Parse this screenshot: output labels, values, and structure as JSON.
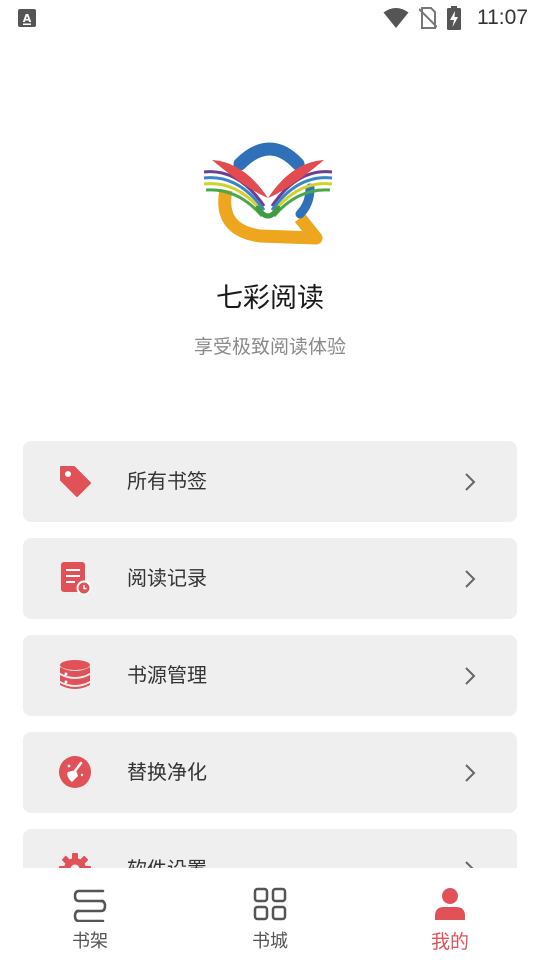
{
  "status_bar": {
    "time": "11:07",
    "icons": [
      "keyboard-a-icon",
      "wifi-icon",
      "no-sim-icon",
      "battery-charging-icon"
    ]
  },
  "header": {
    "logo": "qicai-book-logo",
    "title": "七彩阅读",
    "subtitle": "享受极致阅读体验"
  },
  "menu": {
    "items": [
      {
        "label": "所有书签",
        "icon": "tag-icon"
      },
      {
        "label": "阅读记录",
        "icon": "reading-history-icon"
      },
      {
        "label": "书源管理",
        "icon": "database-icon"
      },
      {
        "label": "替换净化",
        "icon": "broom-icon"
      },
      {
        "label": "软件设置",
        "icon": "gear-icon"
      }
    ]
  },
  "bottom_nav": {
    "items": [
      {
        "label": "书架",
        "icon": "bookshelf-icon"
      },
      {
        "label": "书城",
        "icon": "grid-icon"
      },
      {
        "label": "我的",
        "icon": "user-icon",
        "active": true
      }
    ]
  },
  "colors": {
    "accent": "#e05258",
    "card_bg": "#efefef",
    "text_primary": "#1a1a1a",
    "text_secondary": "#8a8a8a"
  }
}
